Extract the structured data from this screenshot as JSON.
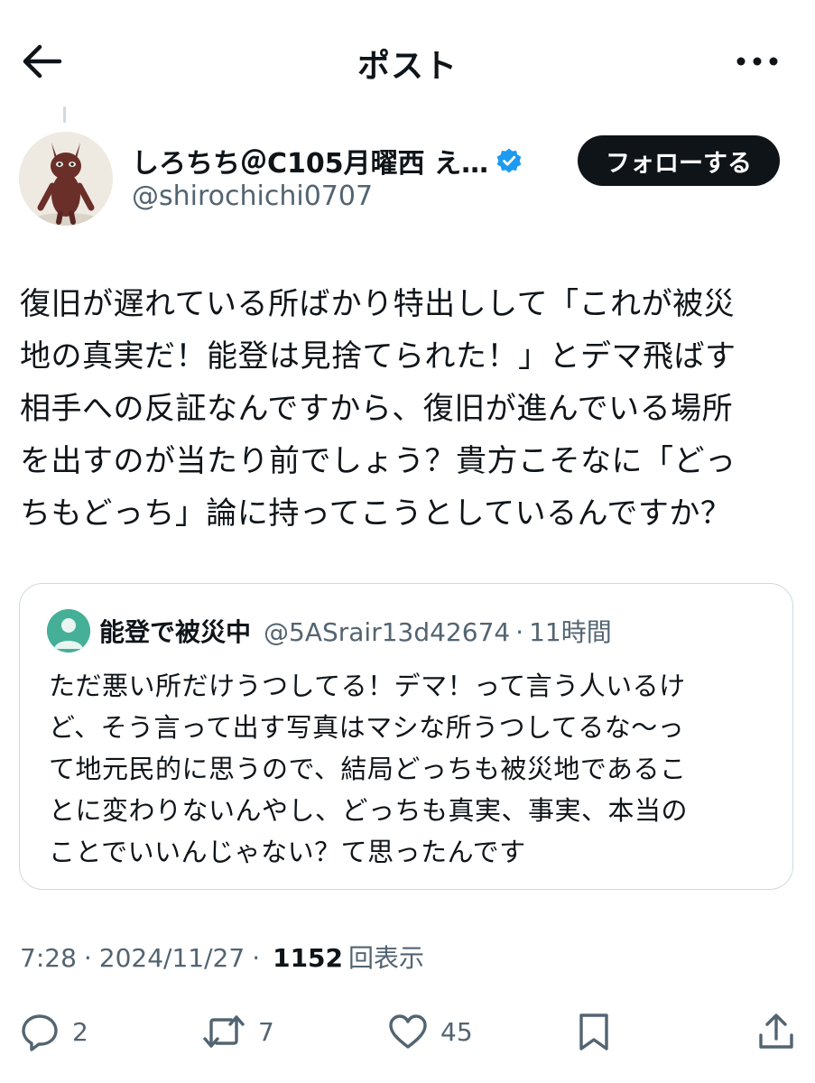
{
  "header": {
    "title": "ポスト",
    "back_icon": "arrow-left-icon",
    "more_icon": "more-horizontal-icon"
  },
  "author": {
    "display_name": "しろちち＠C105月曜西 え…",
    "handle": "@shirochichi0707",
    "verified": true,
    "follow_label": "フォローする"
  },
  "tweet": {
    "lines": [
      "復旧が遅れている所ばかり特出しして「これが被災",
      "地の真実だ！能登は見捨てられた！」とデマ飛ばす",
      "相手への反証なんですから、復旧が進んでいる場所",
      "を出すのが当たり前でしょう？貴方こそなに「どっ",
      "ちもどっち」論に持ってこうとしているんですか？"
    ]
  },
  "quote": {
    "name": "能登で被災中",
    "handle": "@5ASrair13d42674",
    "separator": "·",
    "time": "11時間",
    "lines": [
      "ただ悪い所だけうつしてる！デマ！って言う人いるけ",
      "ど、そう言って出す写真はマシな所うつしてるな〜っ",
      "て地元民的に思うので、結局どっちも被災地であるこ",
      "とに変わりないんやし、どっちも真実、事実、本当の",
      "ことでいいんじゃない？て思ったんです"
    ]
  },
  "meta": {
    "time": "7:28",
    "separator": "·",
    "date": "2024/11/27",
    "views": "1152",
    "views_label": "回表示"
  },
  "actions": {
    "reply_count": "2",
    "repost_count": "7",
    "like_count": "45"
  },
  "colors": {
    "text": "#0f1419",
    "secondary": "#536471",
    "verified_blue": "#1d9bf0",
    "border": "#cfd9de"
  }
}
